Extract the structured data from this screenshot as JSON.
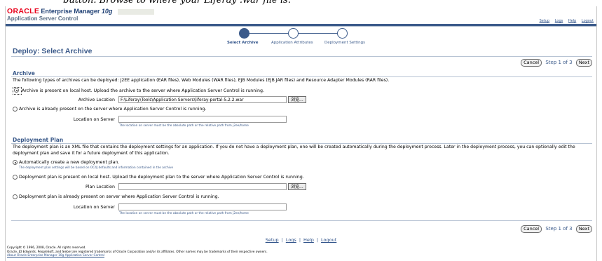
{
  "header_crop_text": "button. Browse to where your Liferay .war file is.",
  "brand": {
    "logo": "ORACLE",
    "product": "Enterprise Manager",
    "version": "10g",
    "subtitle": "Application Server Control"
  },
  "global_links": [
    "Setup",
    "Logs",
    "Help",
    "Logout"
  ],
  "train": {
    "steps": [
      "Select Archive",
      "Application Attributes",
      "Deployment Settings"
    ],
    "active_index": 0
  },
  "page_title": "Deploy: Select Archive",
  "nav": {
    "cancel_label": "Cancel",
    "step_text": "Step 1 of 3",
    "next_label": "Next"
  },
  "archive": {
    "heading": "Archive",
    "description": "The following types of archives can be deployed: J2EE application (EAR files), Web Modules (WAR files), EJB Modules (EJB JAR files) and Resource Adapter Modules (RAR files).",
    "option_local": "Archive is present on local host. Upload the archive to the server where Application Server Control is running.",
    "location_label": "Archive Location",
    "location_value": "F:\\Liferay\\Tools\\Application Servers\\liferay-portal-5.2.2.war",
    "browse_label": "浏览...",
    "option_server": "Archive is already present on the server where Application Server Control is running.",
    "server_location_label": "Location on Server",
    "server_location_value": "",
    "server_hint": "The location on server must be the absolute path or the relative path from j2ee/home"
  },
  "deployment_plan": {
    "heading": "Deployment Plan",
    "description": "The deployment plan is an XML file that contains the deployment settings for an application. If you do not have a deployment plan, one will be created automatically during the deployment process. Later in the deployment process, you can optionally edit the deployment plan and save it for a future deployment of this application.",
    "option_auto": "Automatically create a new deployment plan.",
    "auto_hint": "The deployment plan settings will be based on OC4J defaults and information contained in the archive",
    "option_local": "Deployment plan is present on local host. Upload the deployment plan to the server where Application Server Control is running.",
    "plan_location_label": "Plan Location",
    "plan_location_value": "",
    "browse_label": "浏览...",
    "option_server": "Deployment plan is already present on server where Application Server Control is running.",
    "server_location_label": "Location on Server",
    "server_location_value": "",
    "server_hint": "The location on server must be the absolute path or the relative path from j2ee/home"
  },
  "footer": {
    "links": [
      "Setup",
      "Logs",
      "Help",
      "Logout"
    ],
    "copyright": "Copyright © 1996, 2008, Oracle. All rights reserved.",
    "trademark": "Oracle, JD Edwards, PeopleSoft, and Siebel are registered trademarks of Oracle Corporation and/or its affiliates. Other names may be trademarks of their respective owners.",
    "about_link": "About Oracle Enterprise Manager 10g Application Server Control"
  },
  "colors": {
    "brand_red": "#e8001a",
    "brand_blue": "#3b5a8a",
    "link_blue": "#2c4f87"
  }
}
